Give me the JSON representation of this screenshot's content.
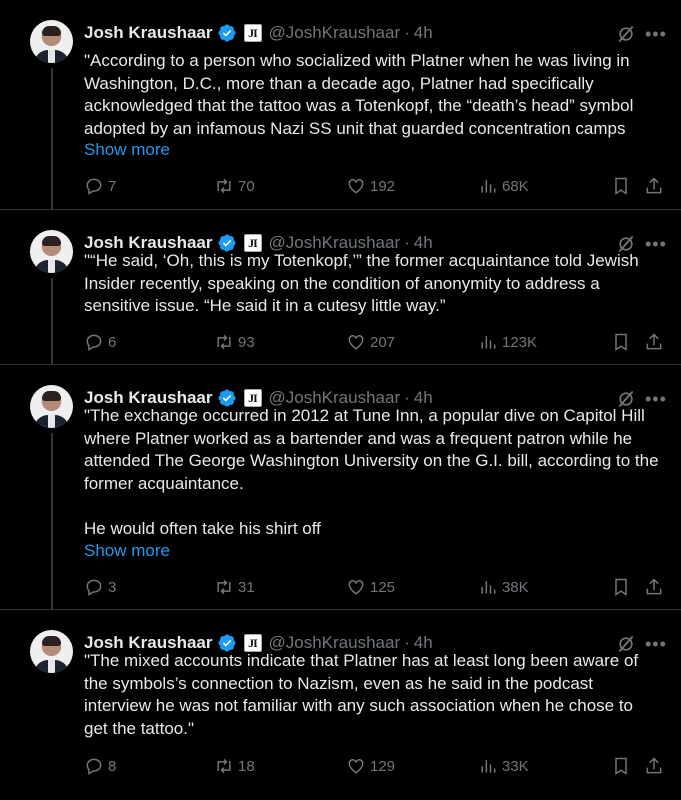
{
  "author": {
    "name": "Josh Kraushaar",
    "handle": "@JoshKraushaar",
    "separator": "·",
    "time": "4h",
    "badge_text": "JI"
  },
  "tweets": [
    {
      "text": "\"According to a person who socialized with Platner when he was living in Washington, D.C., more than a decade ago, Platner had specifically acknowledged that the tattoo was a Totenkopf, the “death’s head” symbol adopted by an infamous Nazi SS unit that guarded concentration camps",
      "show_more": "Show more",
      "replies": "7",
      "reposts": "70",
      "likes": "192",
      "views": "68K"
    },
    {
      "text": "\"“He said, ‘Oh, this is my Totenkopf,’” the former acquaintance told Jewish Insider recently, speaking on the condition of anonymity to address a sensitive issue. “He said it in a cutesy little way.”",
      "show_more": "",
      "replies": "6",
      "reposts": "93",
      "likes": "207",
      "views": "123K"
    },
    {
      "text": "\"The exchange occurred in 2012 at Tune Inn, a popular dive on Capitol Hill where Platner worked as a bartender and was a frequent patron while he attended The George Washington University on the G.I. bill, according to the former acquaintance.\n\nHe would often take his shirt off",
      "show_more": "Show more",
      "replies": "3",
      "reposts": "31",
      "likes": "125",
      "views": "38K"
    },
    {
      "text": "\"The mixed accounts indicate that Platner has at least long been aware of the symbols’s connection to Nazism, even as he said in the podcast interview he was not familiar with any such association when he chose to get the tattoo.\"",
      "show_more": "",
      "replies": "8",
      "reposts": "18",
      "likes": "129",
      "views": "33K"
    }
  ],
  "colors": {
    "background": "#000000",
    "text": "#e7e9ea",
    "muted": "#71767b",
    "link": "#1d9bf0",
    "verified": "#1d9bf0",
    "thread_line": "#333639"
  },
  "icons": [
    "verified-badge-icon",
    "grok-icon",
    "more-icon",
    "reply-icon",
    "repost-icon",
    "like-icon",
    "views-icon",
    "bookmark-icon",
    "share-icon"
  ]
}
